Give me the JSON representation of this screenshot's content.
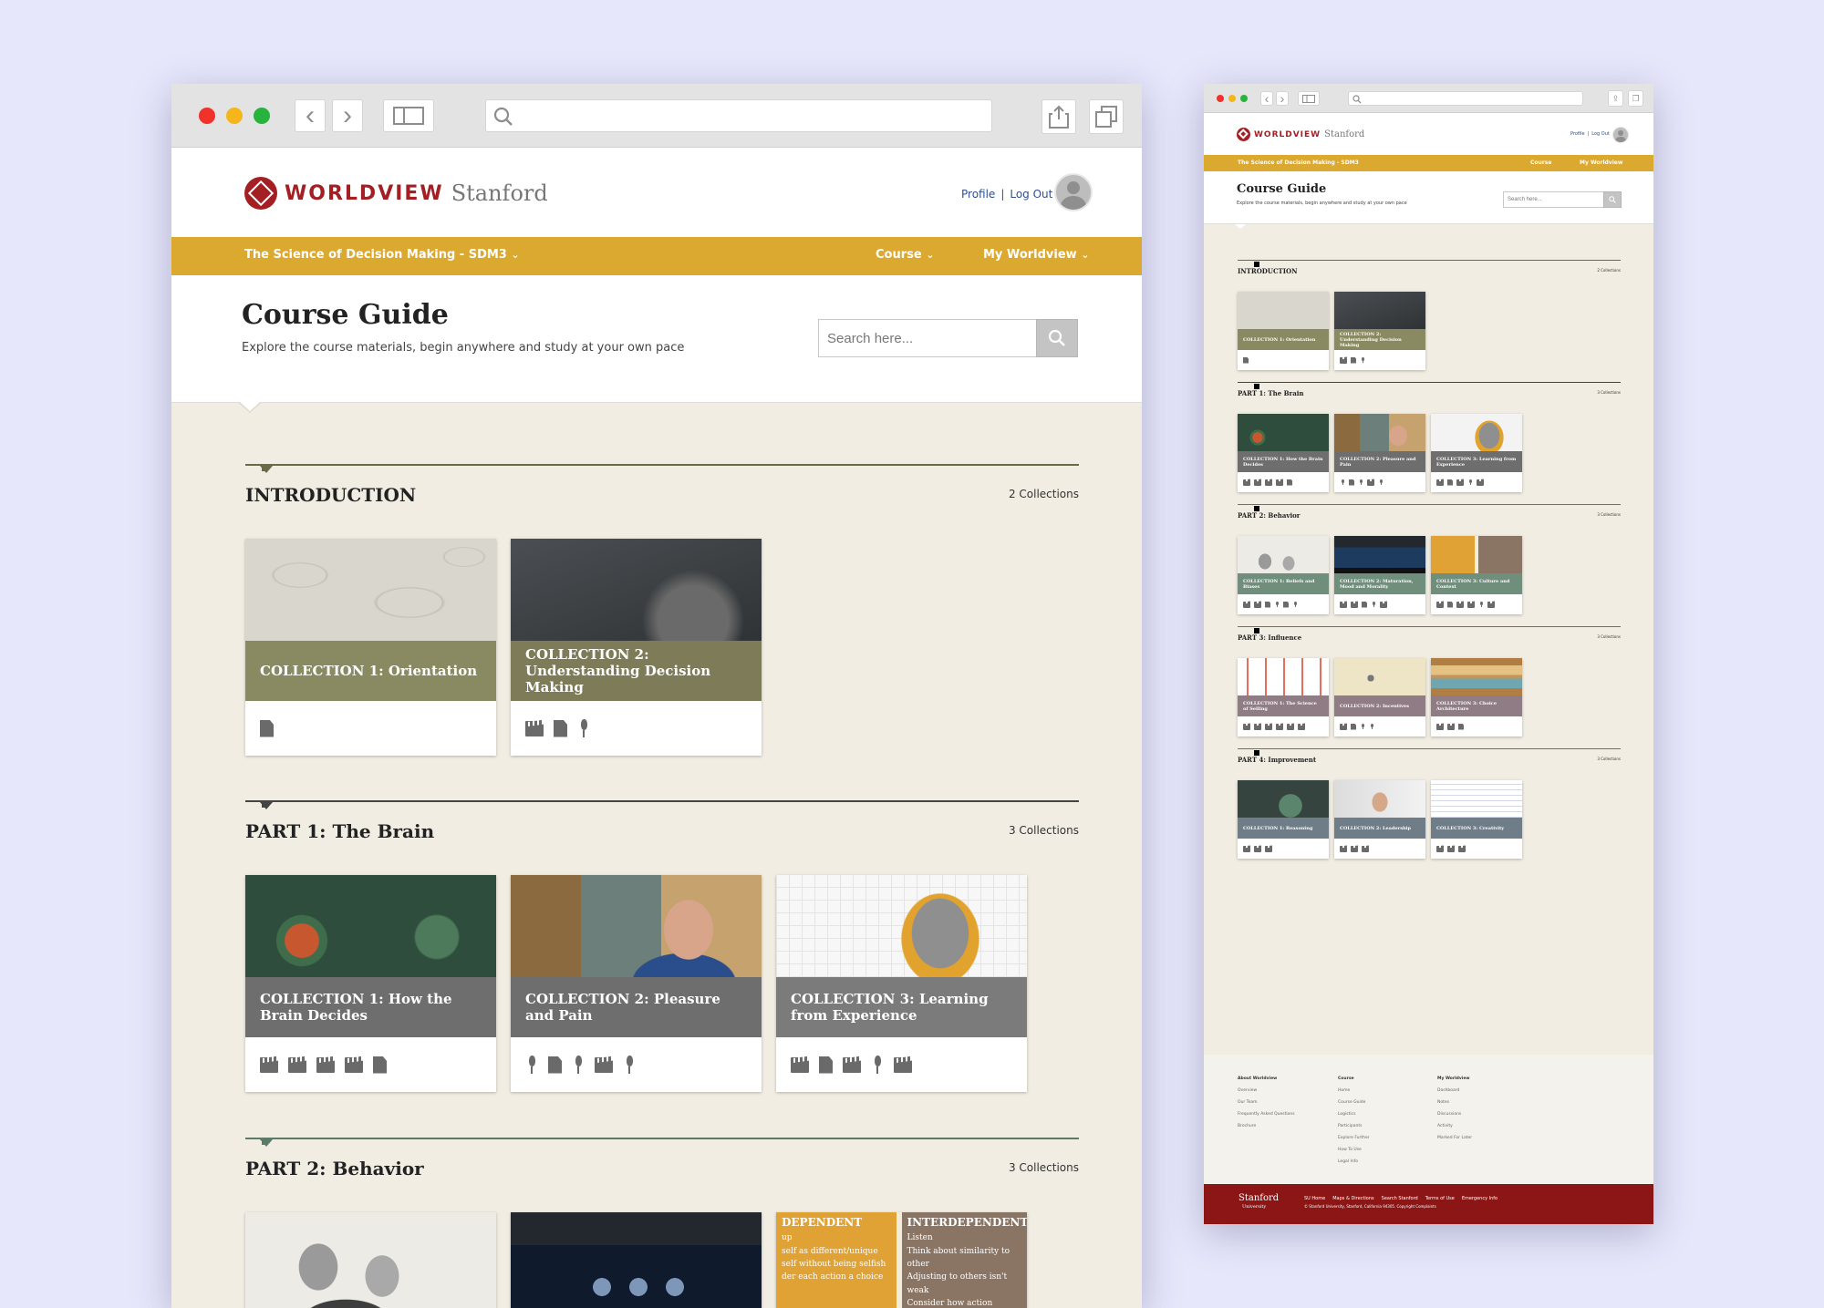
{
  "large": {
    "brand": {
      "word": "WORLDVIEW",
      "stanford": "Stanford"
    },
    "user_links": {
      "profile": "Profile",
      "sep": "|",
      "logout": "Log Out"
    },
    "nav": {
      "course_name": "The Science of Decision Making - SDM3",
      "course": "Course",
      "my_worldview": "My Worldview",
      "caret": "⌄"
    },
    "guide": {
      "title": "Course Guide",
      "subtitle": "Explore the course materials, begin anywhere and study at your own pace",
      "search_placeholder": "Search here..."
    },
    "sections": [
      {
        "title": "INTRODUCTION",
        "count": "2 Collections",
        "cards": [
          {
            "label": "COLLECTION 1: Orientation",
            "icons": [
              "doc"
            ]
          },
          {
            "label": "COLLECTION 2: Understanding Decision Making",
            "icons": [
              "film",
              "doc",
              "mic"
            ]
          }
        ]
      },
      {
        "title": "PART 1: The Brain",
        "count": "3 Collections",
        "cards": [
          {
            "label": "COLLECTION 1: How the Brain Decides",
            "icons": [
              "film",
              "film",
              "film",
              "film",
              "doc"
            ]
          },
          {
            "label": "COLLECTION 2: Pleasure and Pain",
            "icons": [
              "mic",
              "doc",
              "mic",
              "film",
              "mic"
            ]
          },
          {
            "label": "COLLECTION 3: Learning from Experience",
            "icons": [
              "film",
              "doc",
              "film",
              "mic",
              "film"
            ]
          }
        ]
      },
      {
        "title": "PART 2: Behavior",
        "count": "3 Collections",
        "cards": []
      }
    ],
    "behavior_text": {
      "left_head": "DEPENDENT",
      "left_lines": [
        "up",
        "self as different/unique",
        "self without being selfish",
        "der each action a choice"
      ],
      "right_head": "INTERDEPENDENT",
      "right_lines": [
        "Listen",
        "Think about similarity to other",
        "Adjusting to others isn't weak",
        "Consider how action affects o"
      ]
    }
  },
  "small": {
    "brand": {
      "word": "WORLDVIEW",
      "stanford": "Stanford"
    },
    "user_links": {
      "profile": "Profile",
      "sep": "|",
      "logout": "Log Out"
    },
    "nav": {
      "course_name": "The Science of Decision Making - SDM3",
      "course": "Course",
      "my_worldview": "My Worldview"
    },
    "guide": {
      "title": "Course Guide",
      "subtitle": "Explore the course materials, begin anywhere and study at your own pace",
      "search_placeholder": "Search here..."
    },
    "sections": [
      {
        "title": "INTRODUCTION",
        "count": "2 Collections",
        "color": "#8a8a62",
        "cards": [
          {
            "label": "COLLECTION 1: Orientation",
            "icons": [
              "doc"
            ]
          },
          {
            "label": "COLLECTION 2: Understanding Decision Making",
            "icons": [
              "film",
              "doc",
              "mic"
            ]
          }
        ]
      },
      {
        "title": "PART 1: The Brain",
        "count": "3 Collections",
        "color": "#6e6e6e",
        "cards": [
          {
            "label": "COLLECTION 1: How the Brain Decides",
            "icons": [
              "film",
              "film",
              "film",
              "film",
              "doc"
            ]
          },
          {
            "label": "COLLECTION 2: Pleasure and Pain",
            "icons": [
              "mic",
              "doc",
              "mic",
              "film",
              "mic"
            ]
          },
          {
            "label": "COLLECTION 3: Learning from Experience",
            "icons": [
              "film",
              "doc",
              "film",
              "mic",
              "film"
            ]
          }
        ]
      },
      {
        "title": "PART 2: Behavior",
        "count": "3 Collections",
        "color": "#6f8f7c",
        "cards": [
          {
            "label": "COLLECTION 1: Beliefs and Biases",
            "icons": [
              "film",
              "film",
              "doc",
              "mic",
              "doc",
              "mic"
            ]
          },
          {
            "label": "COLLECTION 2: Maturation, Mood and Morality",
            "icons": [
              "film",
              "film",
              "doc",
              "mic",
              "film"
            ]
          },
          {
            "label": "COLLECTION 3: Culture and Context",
            "icons": [
              "film",
              "doc",
              "film",
              "film",
              "mic",
              "film"
            ]
          }
        ]
      },
      {
        "title": "PART 3: Influence",
        "count": "3 Collections",
        "color": "#8f7c84",
        "cards": [
          {
            "label": "COLLECTION 1: The Science of Selling",
            "icons": [
              "film",
              "film",
              "film",
              "film",
              "film",
              "film"
            ]
          },
          {
            "label": "COLLECTION 2: Incentives",
            "icons": [
              "film",
              "doc",
              "mic",
              "mic"
            ]
          },
          {
            "label": "COLLECTION 3: Choice Architecture",
            "icons": [
              "film",
              "film",
              "doc"
            ]
          }
        ]
      },
      {
        "title": "PART 4: Improvement",
        "count": "3 Collections",
        "color": "#6f7d88",
        "cards": [
          {
            "label": "COLLECTION 1: Reasoning",
            "icons": [
              "film",
              "film",
              "film"
            ]
          },
          {
            "label": "COLLECTION 2: Leadership",
            "icons": [
              "film",
              "film",
              "film"
            ]
          },
          {
            "label": "COLLECTION 3: Creativity",
            "icons": [
              "film",
              "film",
              "film"
            ]
          }
        ]
      }
    ],
    "footer": {
      "columns": [
        {
          "heading": "About Worldview",
          "links": [
            "Overview",
            "Our Team",
            "Frequently Asked Questions",
            "Brochure"
          ]
        },
        {
          "heading": "Course",
          "links": [
            "Home",
            "Course Guide",
            "Logistics",
            "Participants",
            "Explore Further",
            "How To Use",
            "Legal Info"
          ]
        },
        {
          "heading": "My Worldview",
          "links": [
            "Dashboard",
            "Notes",
            "Discussions",
            "Activity",
            "Marked For Later"
          ]
        }
      ],
      "stanford": "Stanford",
      "university": "University",
      "links": [
        "SU Home",
        "Maps & Directions",
        "Search Stanford",
        "Terms of Use",
        "Emergency Info"
      ],
      "copyright": "© Stanford University, Stanford, California 94305. Copyright Complaints"
    }
  },
  "colors": {
    "background": "#e6e7fb",
    "nav_gold": "#dba830",
    "brand_red": "#a31f23",
    "footer_red": "#8c1515",
    "olive": "#8a8a62",
    "gray": "#6e6e6e",
    "sage": "#6f8f7c"
  }
}
